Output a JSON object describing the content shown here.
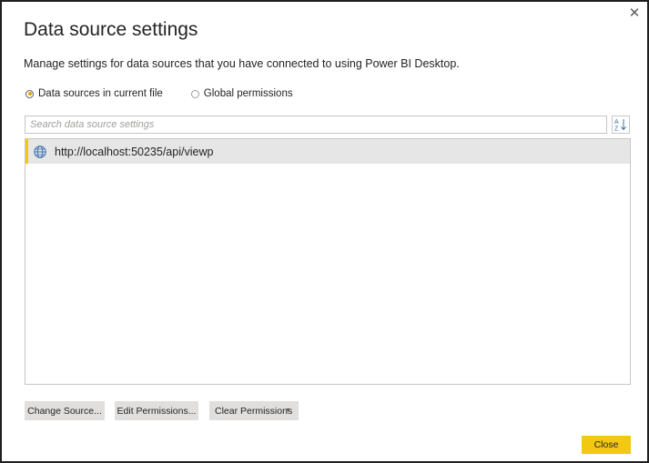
{
  "dialog": {
    "title": "Data source settings",
    "subtitle": "Manage settings for data sources that you have connected to using Power BI Desktop.",
    "close_icon": "close-icon"
  },
  "scope": {
    "options": [
      {
        "label": "Data sources in current file",
        "selected": true
      },
      {
        "label": "Global permissions",
        "selected": false
      }
    ]
  },
  "search": {
    "placeholder": "Search data source settings",
    "sort_icon": "sort-az-icon"
  },
  "sources": [
    {
      "url": "http://localhost:50235/api/viewp",
      "icon": "globe-icon",
      "selected": true
    }
  ],
  "actions": {
    "change_source": "Change Source...",
    "edit_permissions": "Edit Permissions...",
    "clear_permissions": "Clear Permissions"
  },
  "footer": {
    "close_label": "Close"
  },
  "colors": {
    "accent": "#f2c811",
    "selected_row": "#e6e6e6",
    "button_bg": "#e1dfdd"
  }
}
